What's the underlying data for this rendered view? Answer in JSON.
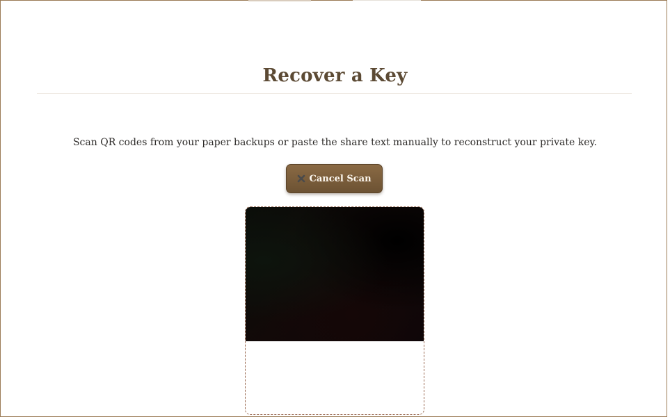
{
  "page": {
    "title": "Recover a Key",
    "instructions": "Scan QR codes from your paper backups or paste the share text manually to reconstruct your private key."
  },
  "actions": {
    "cancel_scan_label": "Cancel Scan",
    "cancel_scan_icon": "close-icon"
  },
  "scanner": {
    "state": "camera-active",
    "icon_color": "#4a4a4a"
  },
  "colors": {
    "title": "#5c4a34",
    "button_bg": "#7a5d3c",
    "frame_border": "#9a7a55",
    "scanner_border": "#9a6a52"
  }
}
